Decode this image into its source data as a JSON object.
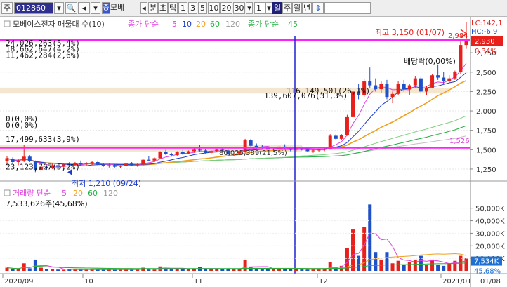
{
  "toolbar": {
    "market": "주",
    "code": "012860",
    "name_button": "모베",
    "prev_label": "◂",
    "period_tick": "분",
    "period_day": "초",
    "period_tick2": "틱",
    "n1": "1",
    "n3": "3",
    "n5": "5",
    "n10": "10",
    "n20": "20",
    "n30": "30",
    "count": "1",
    "day": "일",
    "week": "주",
    "month": "월",
    "year": "년",
    "sort_icon": "⇕"
  },
  "legend": {
    "stock_name": "모베이스전자 매물대 수(10)",
    "ma_title_1": "종가 단순",
    "ma_periods_1": [
      "5",
      "10",
      "20",
      "60",
      "120"
    ],
    "ma_title_2": "종가 단순",
    "ma_periods_2": [
      "45"
    ]
  },
  "right_info": {
    "lc": "LC:142,1",
    "hc": "HC:-6,9",
    "price_box": "2,930",
    "pct": "0,34%",
    "level_1526": "1,526"
  },
  "annotations": {
    "high": "최고 3,150 (01/07)",
    "high_price": "2,984",
    "low": "최저 1,210 (09/24)",
    "dividend": "배당락(0,00%)",
    "box_mid": "86,025,389(21,5%)"
  },
  "volume_profile": [
    {
      "label": "24,026,263(5,4%)"
    },
    {
      "label": "18,662,647(4,2%)"
    },
    {
      "label": "11,462,284(2,6%)"
    },
    {
      "label": "116,149,501(26,1%)"
    },
    {
      "label": "139,607,076(31,3%)"
    },
    {
      "label": "0(0,0%)"
    },
    {
      "label": "0(0,0%)"
    },
    {
      "label": "17,499,633(3,9%)"
    },
    {
      "label": "23,123,767(5,2%)"
    }
  ],
  "volume_panel": {
    "title": "거래량 단순",
    "periods": [
      "5",
      "20",
      "60",
      "120"
    ],
    "last_volume": "7,533,626주(45,68%)",
    "right_last": "7,534K",
    "right_pct": "45,68%"
  },
  "colors": {
    "up": "#e8201c",
    "down": "#1e50c8",
    "ma5": "#e040e0",
    "ma10": "#1e3cc8",
    "ma20": "#f0a020",
    "ma60": "#20b040",
    "ma120": "#c0c0c0",
    "magenta_line": "#ff20ff",
    "cursor": "#2020d0",
    "vprofile": "#f5e6d0"
  },
  "chart_data": {
    "type": "candlestick",
    "price_axis_ticks": [
      "2,750",
      "2,500",
      "2,250",
      "2,000",
      "1,750",
      "1,500",
      "1,250"
    ],
    "volume_axis_ticks": [
      "50,000K",
      "40,000K",
      "30,000K",
      "20,000K",
      "10,000K"
    ],
    "x_ticks": [
      "2020/09",
      "10",
      "11",
      "12",
      "2021/01",
      "01/08"
    ],
    "ylim": [
      1150,
      3050
    ],
    "volume_ylim": [
      0,
      56000
    ],
    "candles": [
      [
        1350,
        1420,
        1300,
        1390
      ],
      [
        1380,
        1400,
        1320,
        1340
      ],
      [
        1340,
        1380,
        1300,
        1360
      ],
      [
        1360,
        1560,
        1340,
        1410
      ],
      [
        1410,
        1430,
        1340,
        1350
      ],
      [
        1350,
        1360,
        1210,
        1240
      ],
      [
        1240,
        1300,
        1210,
        1280
      ],
      [
        1280,
        1300,
        1240,
        1260
      ],
      [
        1260,
        1320,
        1250,
        1300
      ],
      [
        1300,
        1330,
        1270,
        1280
      ],
      [
        1280,
        1320,
        1260,
        1310
      ],
      [
        1310,
        1340,
        1290,
        1300
      ],
      [
        1300,
        1340,
        1290,
        1330
      ],
      [
        1330,
        1360,
        1300,
        1310
      ],
      [
        1310,
        1340,
        1290,
        1320
      ],
      [
        1320,
        1350,
        1300,
        1340
      ],
      [
        1340,
        1360,
        1300,
        1310
      ],
      [
        1310,
        1330,
        1280,
        1290
      ],
      [
        1290,
        1320,
        1270,
        1300
      ],
      [
        1300,
        1310,
        1270,
        1280
      ],
      [
        1280,
        1300,
        1260,
        1290
      ],
      [
        1290,
        1330,
        1280,
        1320
      ],
      [
        1320,
        1340,
        1290,
        1300
      ],
      [
        1300,
        1320,
        1280,
        1310
      ],
      [
        1310,
        1380,
        1300,
        1370
      ],
      [
        1370,
        1420,
        1350,
        1360
      ],
      [
        1360,
        1400,
        1340,
        1390
      ],
      [
        1390,
        1480,
        1380,
        1470
      ],
      [
        1470,
        1500,
        1430,
        1440
      ],
      [
        1440,
        1460,
        1410,
        1430
      ],
      [
        1430,
        1480,
        1420,
        1470
      ],
      [
        1470,
        1500,
        1430,
        1450
      ],
      [
        1450,
        1490,
        1440,
        1480
      ],
      [
        1480,
        1520,
        1460,
        1500
      ],
      [
        1500,
        1560,
        1480,
        1490
      ],
      [
        1490,
        1510,
        1450,
        1460
      ],
      [
        1460,
        1490,
        1440,
        1480
      ],
      [
        1480,
        1510,
        1470,
        1500
      ],
      [
        1500,
        1530,
        1480,
        1490
      ],
      [
        1490,
        1500,
        1430,
        1440
      ],
      [
        1440,
        1460,
        1420,
        1450
      ],
      [
        1450,
        1480,
        1430,
        1470
      ],
      [
        1470,
        1640,
        1460,
        1620
      ],
      [
        1620,
        1640,
        1540,
        1550
      ],
      [
        1550,
        1580,
        1510,
        1530
      ],
      [
        1530,
        1560,
        1500,
        1520
      ],
      [
        1520,
        1550,
        1490,
        1500
      ],
      [
        1500,
        1520,
        1470,
        1510
      ],
      [
        1510,
        1560,
        1500,
        1540
      ],
      [
        1540,
        1570,
        1510,
        1520
      ],
      [
        1520,
        1540,
        1480,
        1500
      ],
      [
        1500,
        1530,
        1480,
        1520
      ],
      [
        1520,
        1540,
        1490,
        1500
      ],
      [
        1500,
        1520,
        1470,
        1480
      ],
      [
        1480,
        1500,
        1460,
        1490
      ],
      [
        1490,
        1510,
        1470,
        1500
      ],
      [
        1500,
        1520,
        1480,
        1510
      ],
      [
        1510,
        1700,
        1500,
        1680
      ],
      [
        1680,
        1700,
        1620,
        1640
      ],
      [
        1640,
        1700,
        1630,
        1690
      ],
      [
        1690,
        1950,
        1680,
        1920
      ],
      [
        1920,
        2280,
        1900,
        2250
      ],
      [
        2250,
        2350,
        2150,
        2200
      ],
      [
        2200,
        2420,
        2180,
        2380
      ],
      [
        2380,
        2560,
        2300,
        2330
      ],
      [
        2330,
        2420,
        2250,
        2280
      ],
      [
        2280,
        2380,
        2230,
        2350
      ],
      [
        2350,
        2400,
        2150,
        2180
      ],
      [
        2180,
        2250,
        2100,
        2220
      ],
      [
        2220,
        2380,
        2200,
        2350
      ],
      [
        2350,
        2400,
        2250,
        2280
      ],
      [
        2280,
        2350,
        2200,
        2330
      ],
      [
        2330,
        2450,
        2300,
        2420
      ],
      [
        2420,
        2450,
        2220,
        2250
      ],
      [
        2250,
        2320,
        2200,
        2300
      ],
      [
        2300,
        2480,
        2290,
        2460
      ],
      [
        2460,
        2600,
        2400,
        2430
      ],
      [
        2430,
        2500,
        2350,
        2380
      ],
      [
        2380,
        2460,
        2360,
        2420
      ],
      [
        2420,
        2520,
        2400,
        2500
      ],
      [
        2500,
        2900,
        2480,
        2850
      ],
      [
        2850,
        3150,
        2800,
        2930
      ]
    ],
    "volumes": [
      2500,
      1500,
      1200,
      6000,
      2000,
      9000,
      2500,
      1500,
      1200,
      1000,
      900,
      1200,
      1000,
      900,
      800,
      1300,
      1100,
      1000,
      900,
      800,
      900,
      1500,
      1000,
      900,
      2500,
      2000,
      1500,
      3500,
      2000,
      1500,
      1800,
      1500,
      1300,
      2000,
      3000,
      1500,
      1200,
      1400,
      1300,
      1500,
      1200,
      1400,
      9000,
      3000,
      2000,
      1500,
      1300,
      1200,
      1700,
      1500,
      1300,
      1200,
      1100,
      1000,
      1200,
      1300,
      1500,
      7000,
      3000,
      4000,
      18000,
      33000,
      12000,
      35000,
      53000,
      15000,
      9000,
      15000,
      6000,
      8000,
      5000,
      7000,
      9000,
      12000,
      5000,
      9000,
      5000,
      4000,
      6000,
      8000,
      12000,
      10000
    ]
  }
}
